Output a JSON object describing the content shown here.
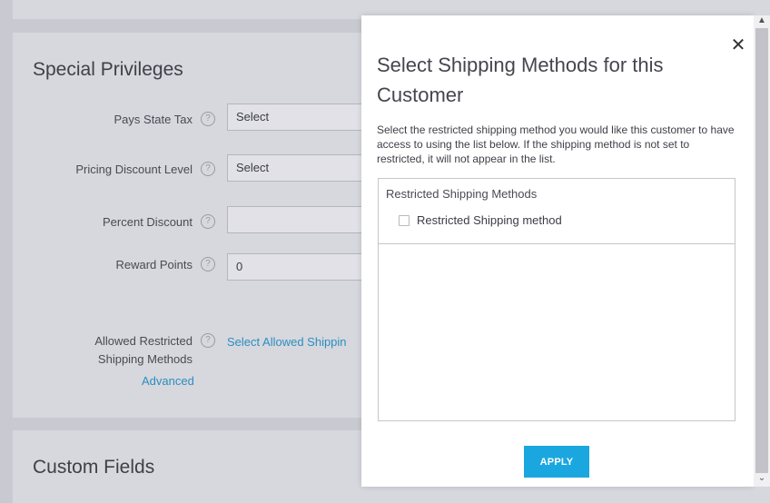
{
  "background": {
    "privileges": {
      "title": "Special Privileges",
      "rows": [
        {
          "label": "Pays State Tax",
          "value": "Select"
        },
        {
          "label": "Pricing Discount Level",
          "value": "Select"
        },
        {
          "label": "Percent Discount",
          "value": ""
        },
        {
          "label": "Reward Points",
          "value": "0"
        }
      ],
      "allowed_label_line1": "Allowed Restricted",
      "allowed_label_line2": "Shipping Methods",
      "advanced_link": "Advanced",
      "allowed_link": "Select Allowed Shippin"
    },
    "custom_fields": {
      "title": "Custom Fields"
    },
    "help_glyph": "?"
  },
  "modal": {
    "title": "Select Shipping Methods for this Customer",
    "description": "Select the restricted shipping method you would like this customer to have access to using the list below. If the shipping method is not set to restricted, it will not appear in the list.",
    "box_title": "Restricted Shipping Methods",
    "options": [
      {
        "label": "Restricted Shipping method",
        "checked": false
      }
    ],
    "apply_label": "APPLY",
    "close_glyph": "✕",
    "accent_color": "#1aa7e0"
  },
  "scrollbar": {
    "up_glyph": "▲",
    "down_glyph": "⌄"
  }
}
